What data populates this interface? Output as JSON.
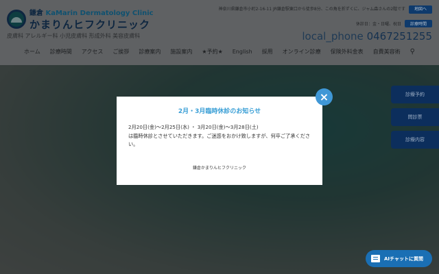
{
  "header": {
    "logo_en_prefix": "鎌倉",
    "logo_en": "KaMarin Dermatology Clinic",
    "logo_ja": "かまりんヒフクリニック",
    "departments": "皮膚科 アレルギー科 小児皮膚科 形成外科 美容皮膚科",
    "address": "神奈川県鎌倉市小町2-16-11 JR鎌倉駅東口から徒歩8分、この角を折ずくに、ジャム森さんの2階です",
    "map_button": "地図へ",
    "closed_days": "休診日：金・日曜、祝日",
    "hours_button": "診療時間",
    "phone_label": "local_phone",
    "phone": "0467251255"
  },
  "nav": [
    "ホーム",
    "診療時間",
    "アクセス",
    "ご挨拶",
    "診療案内",
    "施設案内",
    "★予約★",
    "English",
    "採用",
    "オンライン診療",
    "保険外料金表",
    "自費美容術"
  ],
  "side_buttons": [
    "診療予約",
    "問診票",
    "診療内容"
  ],
  "modal": {
    "title": "2月・3月臨時休診のお知らせ",
    "line1": "2月20日(金)〜2月25日(水) ・ 3月20日(金)〜3月28日(土)",
    "line2": "は臨時休診とさせていただきます。ご迷惑をおかけ致しますが、何卒ご了承ください。",
    "signature": "鎌倉かまりんヒフクリニック",
    "close": "×"
  },
  "chat_button": "AIチャットに質問"
}
